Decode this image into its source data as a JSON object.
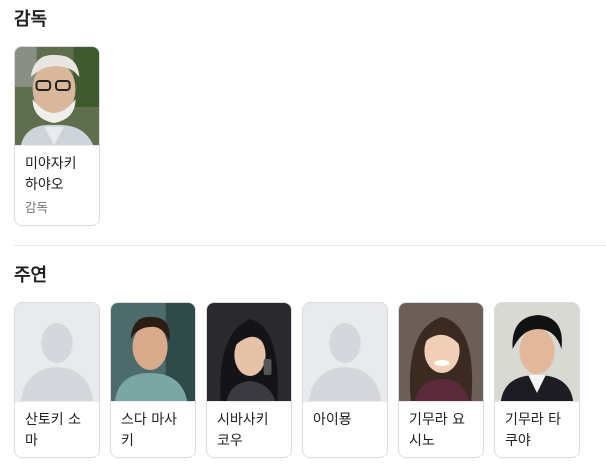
{
  "directors_section": {
    "title": "감독",
    "people": [
      {
        "name_line1": "미야자키",
        "name_line2": "하야오",
        "role": "감독",
        "photo": "director-photo"
      }
    ]
  },
  "cast_section": {
    "title": "주연",
    "people": [
      {
        "name_line1": "산토키 소",
        "name_line2": "마",
        "photo": "placeholder-avatar-icon"
      },
      {
        "name_line1": "스다 마사",
        "name_line2": "키",
        "photo": "actor-photo"
      },
      {
        "name_line1": "시바사키",
        "name_line2": "코우",
        "photo": "actress-photo"
      },
      {
        "name_line1": "아이묭",
        "name_line2": "",
        "photo": "placeholder-avatar-icon"
      },
      {
        "name_line1": "기무라 요",
        "name_line2": "시노",
        "photo": "actress-photo"
      },
      {
        "name_line1": "기무라 타",
        "name_line2": "쿠야",
        "photo": "actor-photo"
      }
    ]
  },
  "colors": {
    "placeholder_bg": "#e8eaed",
    "placeholder_silhouette": "#d4d7dc",
    "border": "#dadce0",
    "secondary_text": "#70757a"
  }
}
